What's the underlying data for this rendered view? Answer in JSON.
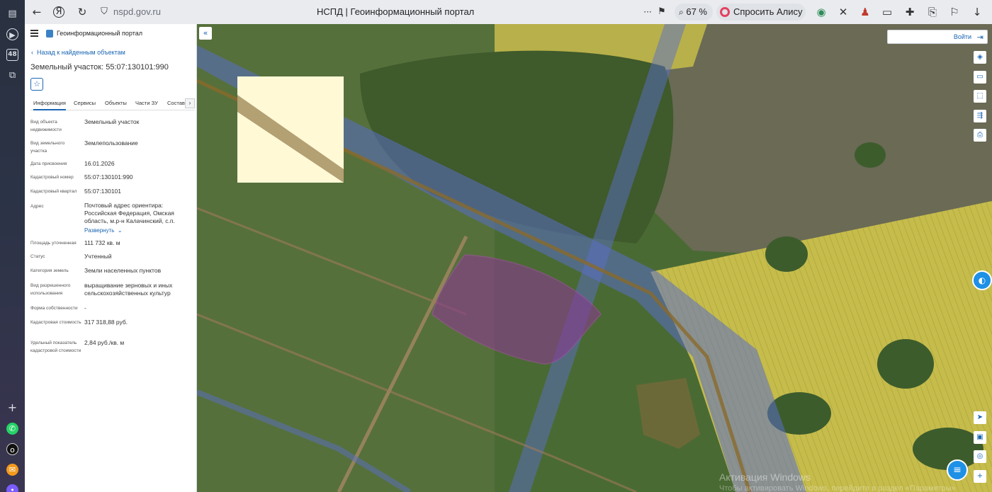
{
  "browser": {
    "url": "nspd.gov.ru",
    "tab_title": "НСПД | Геоинформационный портал",
    "zoom": "67 %",
    "alice_label": "Спросить Алису AI",
    "sidebar_badge": "48"
  },
  "panel": {
    "portal_name": "Геоинформационный портал",
    "back_link": "Назад к найденным объектам",
    "title": "Земельный участок: 55:07:130101:990",
    "tabs": [
      "Информация",
      "Сервисы",
      "Объекты",
      "Части ЗУ",
      "Состав"
    ],
    "expand_label": "Развернуть",
    "rows": [
      {
        "label": "Вид объекта недвижимости",
        "value": "Земельный участок"
      },
      {
        "label": "Вид земельного участка",
        "value": "Землепользование"
      },
      {
        "label": "Дата присвоения",
        "value": "16.01.2026"
      },
      {
        "label": "Кадастровый номер",
        "value": "55:07:130101:990"
      },
      {
        "label": "Кадастровый квартал",
        "value": "55:07:130101"
      },
      {
        "label": "Адрес",
        "value": "Почтовый адрес ориентира: Российская Федерация, Омская область, м.р-н Калачинский, с.п."
      },
      {
        "label": "Площадь уточненная",
        "value": "111 732 кв. м"
      },
      {
        "label": "Статус",
        "value": "Учтенный"
      },
      {
        "label": "Категория земель",
        "value": "Земли населенных пунктов"
      },
      {
        "label": "Вид разрешенного использования",
        "value": "выращивание зерновых и иных сельскохозяйственных культур"
      },
      {
        "label": "Форма собственности",
        "value": "-"
      },
      {
        "label": "Кадастровая стоимость",
        "value": "317 318,88 руб."
      },
      {
        "label": "Удельный показатель кадастровой стоимости",
        "value": "2,84 руб./кв. м"
      }
    ]
  },
  "map": {
    "login_label": "Войти",
    "watermark_line1": "Активация Windows",
    "watermark_line2": "Чтобы активировать Windows, перейдите в раздел «Параметры»"
  },
  "colors": {
    "accent": "#1a66b3",
    "parcel_fill": "#8a3a8f",
    "route_band": "#5a6ec8",
    "field_yellow": "#c9c24a"
  }
}
